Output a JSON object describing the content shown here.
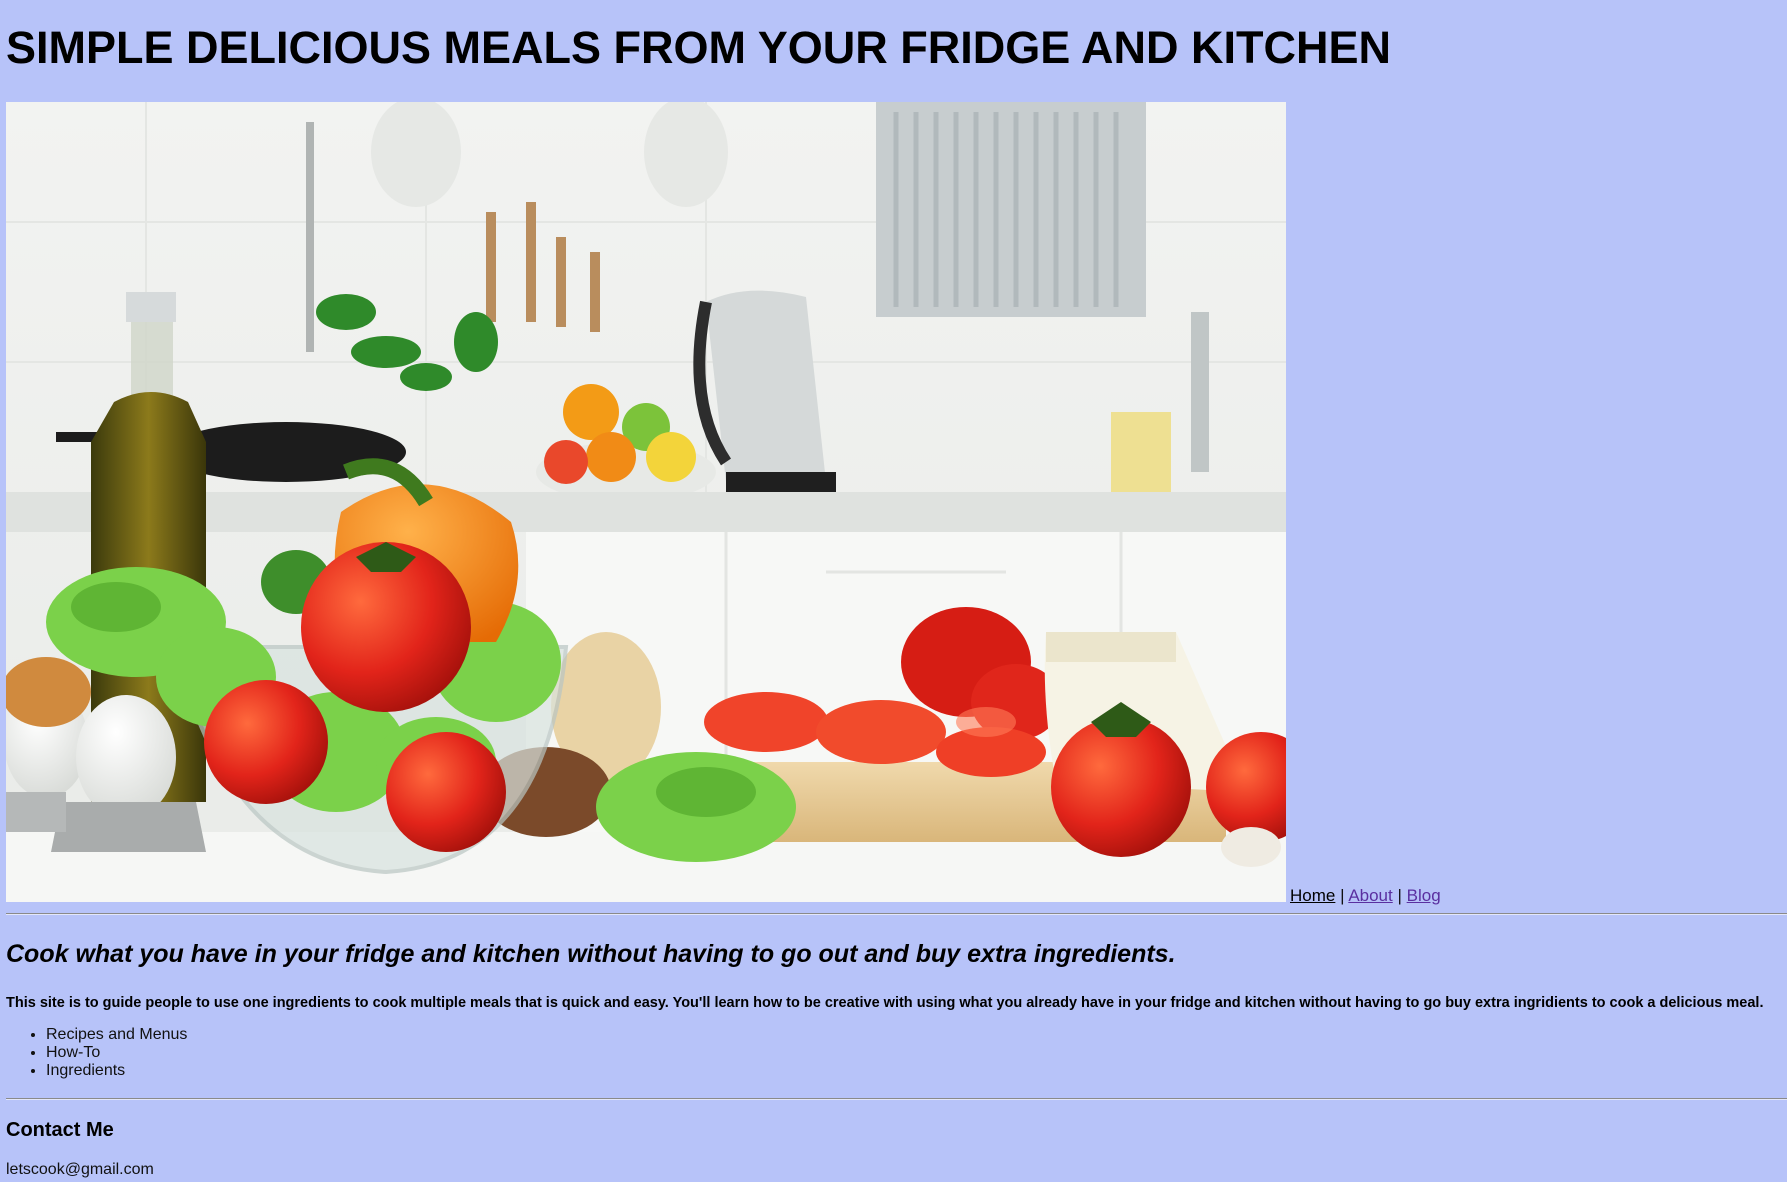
{
  "header": {
    "title": "SIMPLE DELICIOUS MEALS FROM YOUR FRIDGE AND KITCHEN"
  },
  "hero": {
    "image": "kitchen-vegetables-photo"
  },
  "nav": {
    "home": "Home",
    "separator": "|",
    "about": "About",
    "blog": "Blog"
  },
  "main": {
    "tagline": "Cook what you have in your fridge and kitchen without having to go out and buy extra ingredients.",
    "intro": "This site is to guide people to use one ingredients to cook multiple meals that is quick and easy. You'll learn how to be creative with using what you already have in your fridge and kitchen without having to go buy extra ingridients to cook a delicious meal.",
    "topics": [
      "Recipes and Menus",
      "How-To",
      "Ingredients"
    ]
  },
  "contact": {
    "heading": "Contact Me",
    "email": "letscook@gmail.com"
  },
  "colors": {
    "background": "#b7c3f9",
    "visited_link": "#5a2fa0"
  }
}
